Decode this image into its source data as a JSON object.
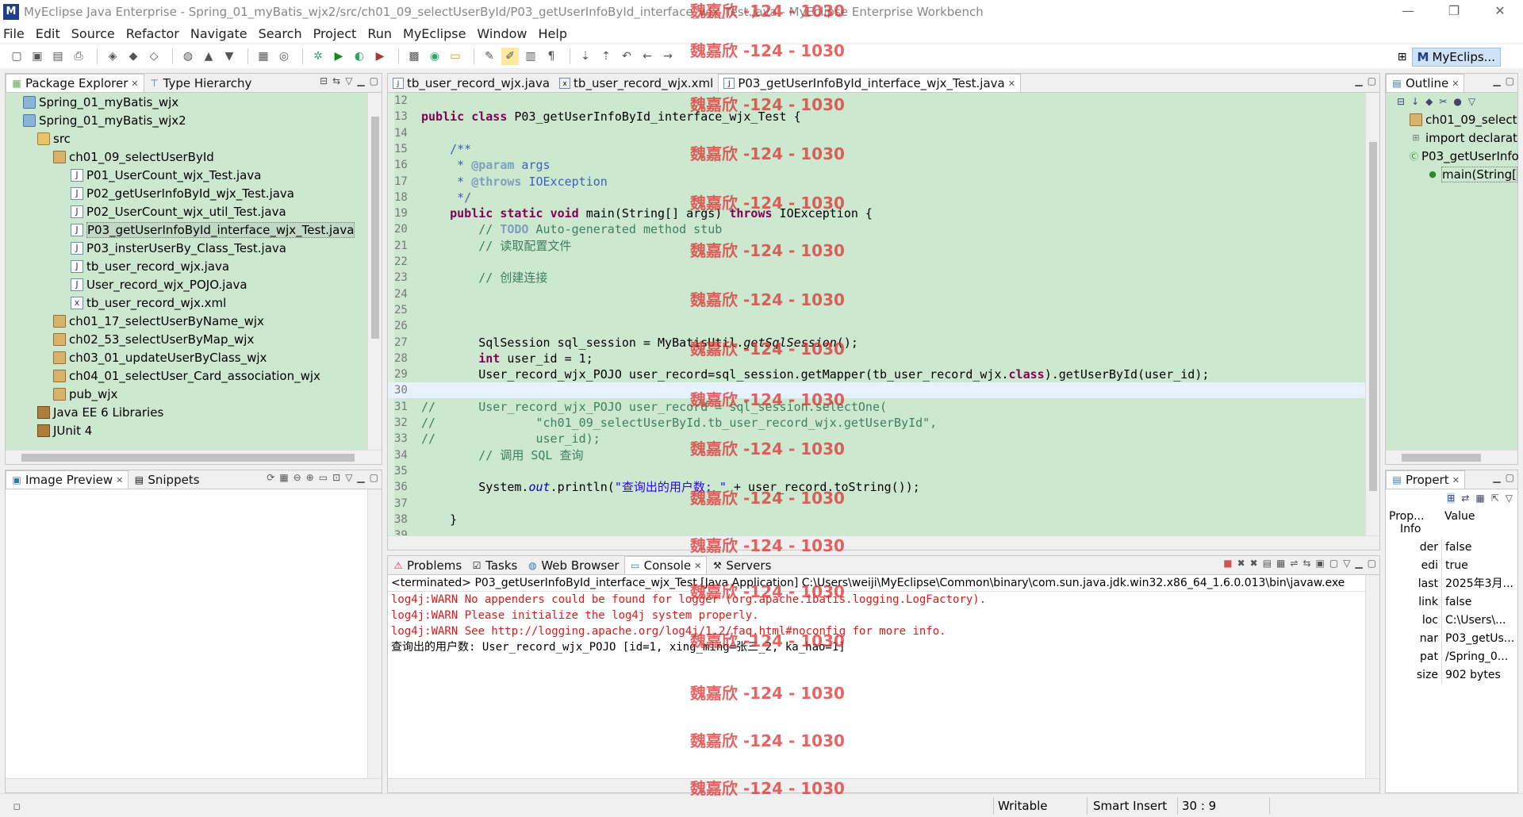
{
  "window": {
    "title": "MyEclipse Java Enterprise - Spring_01_myBatis_wjx2/src/ch01_09_selectUserById/P03_getUserInfoById_interface_wjx_Test.java - MyEclipse Enterprise Workbench",
    "min": "—",
    "max": "❐",
    "close": "✕"
  },
  "menu": [
    "File",
    "Edit",
    "Source",
    "Refactor",
    "Navigate",
    "Search",
    "Project",
    "Run",
    "MyEclipse",
    "Window",
    "Help"
  ],
  "perspective": {
    "label": "MyEclips..."
  },
  "package_explorer": {
    "tabs": [
      "Package Explorer",
      "Type Hierarchy"
    ],
    "items": [
      {
        "label": "Spring_01_myBatis_wjx",
        "icon": "project-icon"
      },
      {
        "label": "Spring_01_myBatis_wjx2",
        "icon": "project-icon"
      },
      {
        "label": "src",
        "icon": "source-folder-icon"
      },
      {
        "label": "ch01_09_selectUserById",
        "icon": "package-icon"
      },
      {
        "label": "P01_UserCount_wjx_Test.java",
        "icon": "java-file-icon"
      },
      {
        "label": "P02_getUserInfoById_wjx_Test.java",
        "icon": "java-file-icon"
      },
      {
        "label": "P02_UserCount_wjx_util_Test.java",
        "icon": "java-file-icon"
      },
      {
        "label": "P03_getUserInfoById_interface_wjx_Test.java",
        "icon": "java-file-icon"
      },
      {
        "label": "P03_insterUserBy_Class_Test.java",
        "icon": "java-file-icon"
      },
      {
        "label": "tb_user_record_wjx.java",
        "icon": "java-file-icon"
      },
      {
        "label": "User_record_wjx_POJO.java",
        "icon": "java-file-icon"
      },
      {
        "label": "tb_user_record_wjx.xml",
        "icon": "xml-file-icon"
      },
      {
        "label": "ch01_17_selectUserByName_wjx",
        "icon": "package-icon"
      },
      {
        "label": "ch02_53_selectUserByMap_wjx",
        "icon": "package-icon"
      },
      {
        "label": "ch03_01_updateUserByClass_wjx",
        "icon": "package-icon"
      },
      {
        "label": "ch04_01_selectUser_Card_association_wjx",
        "icon": "package-icon"
      },
      {
        "label": "pub_wjx",
        "icon": "package-icon"
      },
      {
        "label": "Java EE 6 Libraries",
        "icon": "library-icon"
      },
      {
        "label": "JUnit 4",
        "icon": "library-icon"
      }
    ]
  },
  "image_preview": {
    "tabs": [
      "Image Preview",
      "Snippets"
    ]
  },
  "editor": {
    "tabs": [
      "tb_user_record_wjx.java",
      "tb_user_record_wjx.xml",
      "P03_getUserInfoById_interface_wjx_Test.java"
    ],
    "lines": [
      {
        "n": "12",
        "t": ""
      },
      {
        "n": "13",
        "t": "public class P03_getUserInfoById_interface_wjx_Test {"
      },
      {
        "n": "14",
        "t": ""
      },
      {
        "n": "15",
        "t": "    /**"
      },
      {
        "n": "16",
        "t": "     * @param args"
      },
      {
        "n": "17",
        "t": "     * @throws IOException"
      },
      {
        "n": "18",
        "t": "     */"
      },
      {
        "n": "19",
        "t": "    public static void main(String[] args) throws IOException {"
      },
      {
        "n": "20",
        "t": "        // TODO Auto-generated method stub"
      },
      {
        "n": "21",
        "t": "        // 读取配置文件"
      },
      {
        "n": "22",
        "t": ""
      },
      {
        "n": "23",
        "t": "        // 创建连接"
      },
      {
        "n": "24",
        "t": ""
      },
      {
        "n": "25",
        "t": ""
      },
      {
        "n": "26",
        "t": ""
      },
      {
        "n": "27",
        "t": "        SqlSession sql_session = MyBatisUtil.getSqlSession();"
      },
      {
        "n": "28",
        "t": "        int user_id = 1;"
      },
      {
        "n": "29",
        "t": "        User_record_wjx_POJO user_record=sql_session.getMapper(tb_user_record_wjx.class).getUserById(user_id);"
      },
      {
        "n": "30",
        "t": ""
      },
      {
        "n": "31",
        "t": "//      User_record_wjx_POJO user_record = sql_session.selectOne("
      },
      {
        "n": "32",
        "t": "//              \"ch01_09_selectUserById.tb_user_record_wjx.getUserById\","
      },
      {
        "n": "33",
        "t": "//              user_id);"
      },
      {
        "n": "34",
        "t": "        // 调用 SQL 查询"
      },
      {
        "n": "35",
        "t": ""
      },
      {
        "n": "36",
        "t": "        System.out.println(\"查询出的用户数: \" + user_record.toString());"
      },
      {
        "n": "37",
        "t": ""
      },
      {
        "n": "38",
        "t": "    }"
      },
      {
        "n": "39",
        "t": ""
      }
    ]
  },
  "console": {
    "tabs": [
      "Problems",
      "Tasks",
      "Web Browser",
      "Console",
      "Servers"
    ],
    "header": "<terminated> P03_getUserInfoById_interface_wjx_Test [Java Application] C:\\Users\\weiji\\MyEclipse\\Common\\binary\\com.sun.java.jdk.win32.x86_64_1.6.0.013\\bin\\javaw.exe",
    "lines": [
      {
        "t": "log4j:WARN No appenders could be found for logger (org.apache.ibatis.logging.LogFactory).",
        "err": true
      },
      {
        "t": "log4j:WARN Please initialize the log4j system properly.",
        "err": true
      },
      {
        "t": "log4j:WARN See http://logging.apache.org/log4j/1.2/faq.html#noconfig for more info.",
        "err": true
      },
      {
        "t": "查询出的用户数: User_record_wjx_POJO [id=1, xing_ming=张三_2, ka_hao=1]",
        "err": false
      }
    ]
  },
  "outline": {
    "tab": "Outline",
    "items": [
      {
        "label": "ch01_09_select",
        "icon": "package-icon",
        "indent": 1
      },
      {
        "label": "import declarat",
        "icon": "imports-icon",
        "indent": 1
      },
      {
        "label": "P03_getUserInfo",
        "icon": "class-icon",
        "indent": 1
      },
      {
        "label": "main(String[",
        "icon": "method-icon",
        "indent": 2
      }
    ]
  },
  "properties": {
    "tab": "Propert",
    "col_prop": "Prop...",
    "col_value": "Value",
    "group": "Info",
    "rows": [
      {
        "k": "der",
        "v": "false"
      },
      {
        "k": "edi",
        "v": "true"
      },
      {
        "k": "last",
        "v": "2025年3月..."
      },
      {
        "k": "link",
        "v": "false"
      },
      {
        "k": "loc",
        "v": "C:\\Users\\..."
      },
      {
        "k": "nar",
        "v": "P03_getUs..."
      },
      {
        "k": "pat",
        "v": "/Spring_0..."
      },
      {
        "k": "size",
        "v": "902  bytes"
      }
    ]
  },
  "status": {
    "writable": "Writable",
    "insert_mode": "Smart Insert",
    "position": "30 : 9"
  },
  "watermark": "魏嘉欣 -124 - 1030"
}
